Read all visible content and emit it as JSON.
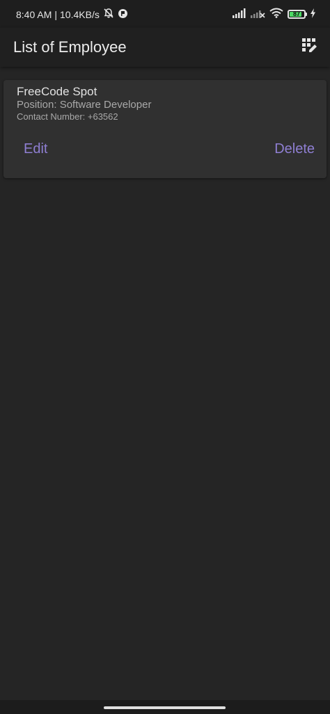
{
  "status_bar": {
    "time": "8:40 AM",
    "separator": "|",
    "network_speed": "10.4KB/s",
    "battery_level": "87",
    "battery_fraction": 0.87,
    "icons": [
      "bell-off-icon",
      "app-notification-icon",
      "signal-icon",
      "signal-no-service-icon",
      "wifi-icon",
      "battery-icon",
      "charging-bolt-icon"
    ]
  },
  "app_bar": {
    "title": "List of Employee",
    "action_icon": "edit-grid-icon"
  },
  "employees": [
    {
      "name": "FreeCode Spot",
      "position": "Position: Software Developer",
      "contact": "Contact Number: +63562",
      "edit_label": "Edit",
      "delete_label": "Delete"
    }
  ],
  "colors": {
    "background": "#252525",
    "card": "#303030",
    "app_bar": "#202020",
    "accent": "#8f7fd3",
    "battery": "#4cd964"
  }
}
